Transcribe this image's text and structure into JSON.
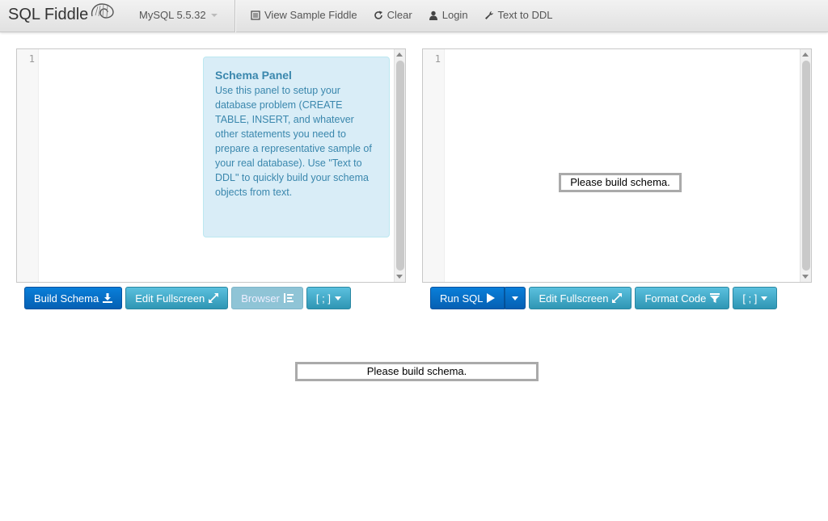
{
  "navbar": {
    "brand": "SQL Fiddle",
    "db_version": "MySQL 5.5.32",
    "items": [
      {
        "label": "View Sample Fiddle",
        "icon": "list-icon"
      },
      {
        "label": "Clear",
        "icon": "refresh-icon"
      },
      {
        "label": "Login",
        "icon": "user-icon"
      },
      {
        "label": "Text to DDL",
        "icon": "wrench-icon"
      }
    ]
  },
  "schema_panel": {
    "line_number": "1",
    "help_title": "Schema Panel",
    "help_text": "Use this panel to setup your database problem (CREATE TABLE, INSERT, and whatever other statements you need to prepare a representative sample of your real database). Use \"Text to DDL\" to quickly build your schema objects from text.",
    "buttons": {
      "build": "Build Schema",
      "fullscreen": "Edit Fullscreen",
      "browser": "Browser",
      "delimiter": "[ ; ]"
    }
  },
  "sql_panel": {
    "line_number": "1",
    "status": "Please build schema.",
    "buttons": {
      "run": "Run SQL",
      "fullscreen": "Edit Fullscreen",
      "format": "Format Code",
      "delimiter": "[ ; ]"
    }
  },
  "results": {
    "status": "Please build schema."
  },
  "colors": {
    "primary": "#0560b3",
    "info": "#2f96b4",
    "help_bg": "#d9edf7",
    "help_text": "#3a87ad"
  }
}
